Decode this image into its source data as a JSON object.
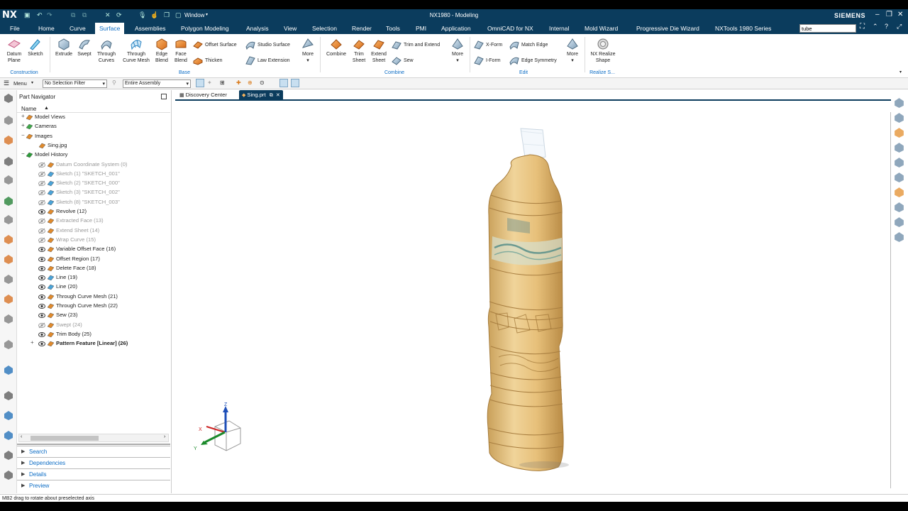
{
  "app": {
    "logo": "NX",
    "window_menu": "Window",
    "title": "NX1980 - Modeling",
    "brand": "SIEMENS"
  },
  "menu_tabs": [
    "File",
    "Home",
    "Curve",
    "Surface",
    "Assemblies",
    "Polygon Modeling",
    "Analysis",
    "View",
    "Selection",
    "Render",
    "Tools",
    "PMI",
    "Application",
    "OmniCAD for NX",
    "Internal",
    "Mold Wizard",
    "Progressive Die Wizard",
    "NXTools 1980 Series"
  ],
  "active_tab": "Surface",
  "search": {
    "value": "tube"
  },
  "ribbon": {
    "construction": {
      "datum_plane": "Datum Plane",
      "sketch": "Sketch",
      "group": "Construction"
    },
    "base": {
      "extrude": "Extrude",
      "swept": "Swept",
      "through_curves": "Through Curves",
      "through_curve_mesh": "Through Curve Mesh",
      "edge_blend": "Edge Blend",
      "face_blend": "Face Blend",
      "offset_surface": "Offset Surface",
      "thicken": "Thicken",
      "studio_surface": "Studio Surface",
      "law_extension": "Law Extension",
      "more": "More",
      "group": "Base"
    },
    "combine": {
      "combine": "Combine",
      "trim_sheet": "Trim Sheet",
      "extend_sheet": "Extend Sheet",
      "trim_and_extend": "Trim and Extend",
      "sew": "Sew",
      "more": "More",
      "group": "Combine"
    },
    "edit": {
      "x_form": "X-Form",
      "i_form": "I-Form",
      "match_edge": "Match Edge",
      "edge_symmetry": "Edge Symmetry",
      "more": "More",
      "group": "Edit"
    },
    "realize": {
      "nx_realize_shape": "NX Realize Shape",
      "group": "Realize S..."
    }
  },
  "selection_bar": {
    "menu": "Menu",
    "filter": "No Selection Filter",
    "scope": "Entire Assembly"
  },
  "navigator": {
    "title": "Part Navigator",
    "column": "Name",
    "items": [
      {
        "label": "Model Views",
        "level": 1,
        "dim": false,
        "eye": false,
        "expand": "+"
      },
      {
        "label": "Cameras",
        "level": 1,
        "dim": false,
        "eye": false,
        "expand": "+"
      },
      {
        "label": "Images",
        "level": 1,
        "dim": false,
        "eye": false,
        "expand": "-"
      },
      {
        "label": "Sing.jpg",
        "level": 2,
        "dim": false,
        "eye": false,
        "expand": ""
      },
      {
        "label": "Model History",
        "level": 1,
        "dim": false,
        "eye": false,
        "expand": "-"
      },
      {
        "label": "Datum Coordinate System (0)",
        "level": 2,
        "dim": true,
        "eye": true,
        "expand": ""
      },
      {
        "label": "Sketch (1) \"SKETCH_001\"",
        "level": 2,
        "dim": true,
        "eye": true,
        "expand": ""
      },
      {
        "label": "Sketch (2) \"SKETCH_000\"",
        "level": 2,
        "dim": true,
        "eye": true,
        "expand": ""
      },
      {
        "label": "Sketch (3) \"SKETCH_002\"",
        "level": 2,
        "dim": true,
        "eye": true,
        "expand": ""
      },
      {
        "label": "Sketch (8) \"SKETCH_003\"",
        "level": 2,
        "dim": true,
        "eye": true,
        "expand": ""
      },
      {
        "label": "Revolve (12)",
        "level": 2,
        "dim": false,
        "eye": true,
        "expand": ""
      },
      {
        "label": "Extracted Face (13)",
        "level": 2,
        "dim": true,
        "eye": true,
        "expand": ""
      },
      {
        "label": "Extend Sheet (14)",
        "level": 2,
        "dim": true,
        "eye": true,
        "expand": ""
      },
      {
        "label": "Wrap Curve (15)",
        "level": 2,
        "dim": true,
        "eye": true,
        "expand": ""
      },
      {
        "label": "Variable Offset Face (16)",
        "level": 2,
        "dim": false,
        "eye": true,
        "expand": ""
      },
      {
        "label": "Offset Region (17)",
        "level": 2,
        "dim": false,
        "eye": true,
        "expand": ""
      },
      {
        "label": "Delete Face (18)",
        "level": 2,
        "dim": false,
        "eye": true,
        "expand": ""
      },
      {
        "label": "Line (19)",
        "level": 2,
        "dim": false,
        "eye": true,
        "expand": ""
      },
      {
        "label": "Line (20)",
        "level": 2,
        "dim": false,
        "eye": true,
        "expand": ""
      },
      {
        "label": "Through Curve Mesh (21)",
        "level": 2,
        "dim": false,
        "eye": true,
        "expand": ""
      },
      {
        "label": "Through Curve Mesh (22)",
        "level": 2,
        "dim": false,
        "eye": true,
        "expand": ""
      },
      {
        "label": "Sew (23)",
        "level": 2,
        "dim": false,
        "eye": true,
        "expand": ""
      },
      {
        "label": "Swept (24)",
        "level": 2,
        "dim": true,
        "eye": true,
        "expand": ""
      },
      {
        "label": "Trim Body (25)",
        "level": 2,
        "dim": false,
        "eye": true,
        "expand": ""
      },
      {
        "label": "Pattern Feature [Linear] (26)",
        "level": 2,
        "dim": false,
        "eye": true,
        "expand": "+",
        "bold": true
      }
    ],
    "panels": [
      "Search",
      "Dependencies",
      "Details",
      "Preview"
    ]
  },
  "doc_tabs": [
    {
      "label": "Discovery Center",
      "active": false
    },
    {
      "label": "Sing.prt",
      "active": true
    }
  ],
  "triad": {
    "z": "Z",
    "x": "X",
    "y": "Y"
  },
  "status": "MB2 drag to rotate about preselected axis",
  "colors": {
    "header": "#0b3c5d",
    "accent": "#0b6cc5",
    "bottle": "#e3c07c"
  }
}
